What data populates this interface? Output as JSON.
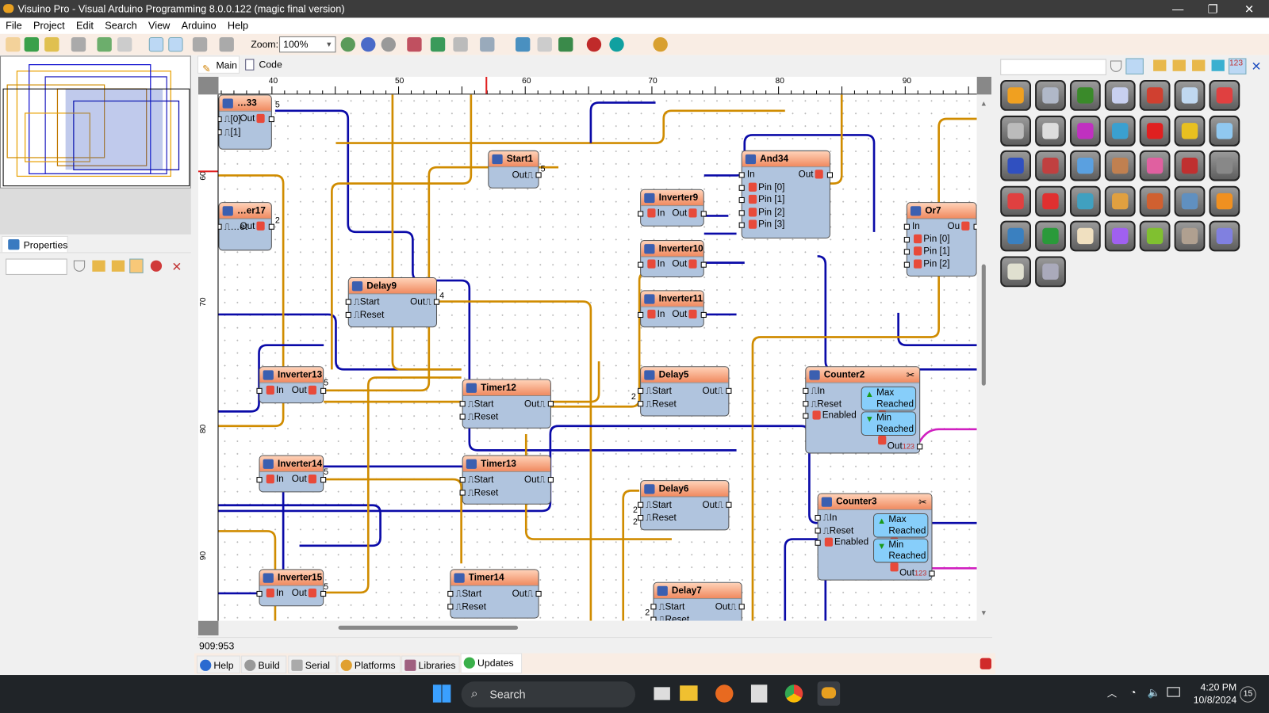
{
  "window": {
    "title": "Visuino Pro - Visual Arduino Programming 8.0.0.122 (magic final version)",
    "minimize": "—",
    "restore": "❐",
    "close": "✕"
  },
  "menu": [
    "File",
    "Project",
    "Edit",
    "Search",
    "View",
    "Arduino",
    "Help"
  ],
  "toolbar": {
    "zoom_label": "Zoom:",
    "zoom_value": "100%"
  },
  "editor_tabs": [
    {
      "label": "Main",
      "active": true
    },
    {
      "label": "Code",
      "active": false
    }
  ],
  "ruler": {
    "top_ticks": [
      "40",
      "50",
      "60",
      "70",
      "80",
      "90"
    ],
    "left_ticks": [
      "60",
      "70",
      "80",
      "90"
    ]
  },
  "properties": {
    "tab_label": "Properties",
    "search_value": ""
  },
  "palette": {
    "search_value": "",
    "icons": [
      "date-time",
      "pump",
      "memory",
      "panel",
      "math-plus",
      "calculator",
      "chart-filter",
      "speaker",
      "binary",
      "hex",
      "telescope",
      "touch",
      "traffic-light",
      "rotate",
      "network",
      "factory",
      "image",
      "gyro",
      "color-matrix",
      "numbers",
      "keypad",
      "chart",
      "power",
      "convert",
      "currency",
      "text",
      "net-link",
      "box",
      "m5stack",
      "grove",
      "filter-doc",
      "color-wheel",
      "expand",
      "caliper",
      "gamepad",
      "module",
      "motor"
    ]
  },
  "components": [
    {
      "name": "…33",
      "pins_in": [
        "[0]",
        "[1]"
      ],
      "pins_out": [
        "Out"
      ],
      "type": "partial"
    },
    {
      "name": "…er17",
      "pins_in": [
        "…et"
      ],
      "pins_out": [
        "Out"
      ],
      "type": "partial"
    },
    {
      "name": "Start1",
      "pins_in": [],
      "pins_out": [
        "Out"
      ]
    },
    {
      "name": "Delay9",
      "pins_in": [
        "Start",
        "Reset"
      ],
      "pins_out": [
        "Out"
      ]
    },
    {
      "name": "Inverter9",
      "pins_in": [
        "In"
      ],
      "pins_out": [
        "Out"
      ]
    },
    {
      "name": "Inverter10",
      "pins_in": [
        "In"
      ],
      "pins_out": [
        "Out"
      ]
    },
    {
      "name": "Inverter11",
      "pins_in": [
        "In"
      ],
      "pins_out": [
        "Out"
      ]
    },
    {
      "name": "And34",
      "pins_in": [
        "In",
        "Pin [0]",
        "Pin [1]",
        "Pin [2]",
        "Pin [3]"
      ],
      "pins_out": [
        "Out"
      ]
    },
    {
      "name": "Or7",
      "pins_in": [
        "In",
        "Pin [0]",
        "Pin [1]",
        "Pin [2]"
      ],
      "pins_out": [
        "Ou"
      ]
    },
    {
      "name": "Inverter13",
      "pins_in": [
        "In"
      ],
      "pins_out": [
        "Out"
      ]
    },
    {
      "name": "Timer12",
      "pins_in": [
        "Start",
        "Reset"
      ],
      "pins_out": [
        "Out"
      ]
    },
    {
      "name": "Delay5",
      "pins_in": [
        "Start",
        "Reset"
      ],
      "pins_out": [
        "Out"
      ]
    },
    {
      "name": "Counter2",
      "pins_in": [
        "In",
        "Reset",
        "Enabled"
      ],
      "pins_out": [
        "Out"
      ],
      "max": [
        "Max",
        "Reached"
      ],
      "min": [
        "Min",
        "Reached"
      ]
    },
    {
      "name": "Inverter14",
      "pins_in": [
        "In"
      ],
      "pins_out": [
        "Out"
      ]
    },
    {
      "name": "Timer13",
      "pins_in": [
        "Start",
        "Reset"
      ],
      "pins_out": [
        "Out"
      ]
    },
    {
      "name": "Delay6",
      "pins_in": [
        "Start",
        "Reset"
      ],
      "pins_out": [
        "Out"
      ]
    },
    {
      "name": "Counter3",
      "pins_in": [
        "In",
        "Reset",
        "Enabled"
      ],
      "pins_out": [
        "Out"
      ],
      "max": [
        "Max",
        "Reached"
      ],
      "min": [
        "Min",
        "Reached"
      ]
    },
    {
      "name": "Inverter15",
      "pins_in": [
        "In"
      ],
      "pins_out": [
        "Out"
      ]
    },
    {
      "name": "Timer14",
      "pins_in": [
        "Start",
        "Reset"
      ],
      "pins_out": [
        "Out"
      ]
    },
    {
      "name": "Delay7",
      "pins_in": [
        "Start",
        "Reset"
      ],
      "pins_out": [
        "Out"
      ]
    }
  ],
  "wire_counts": [
    "5",
    "2",
    "5",
    "4",
    "2",
    "5",
    "5",
    "5",
    "2",
    "2",
    "2"
  ],
  "colors": {
    "wire_digital": "#d08c00",
    "wire_bool": "#0a0aa8",
    "wire_analog": "#d020c0",
    "component_body": "#b0c4de",
    "component_header": "#f08a60"
  },
  "status": {
    "coords": "909:953"
  },
  "bottom_tabs": [
    {
      "label": "Help"
    },
    {
      "label": "Build"
    },
    {
      "label": "Serial"
    },
    {
      "label": "Platforms"
    },
    {
      "label": "Libraries"
    },
    {
      "label": "Updates",
      "active": true
    }
  ],
  "taskbar": {
    "search_placeholder": "Search",
    "time": "4:20 PM",
    "date": "10/8/2024",
    "notifications": "15"
  }
}
